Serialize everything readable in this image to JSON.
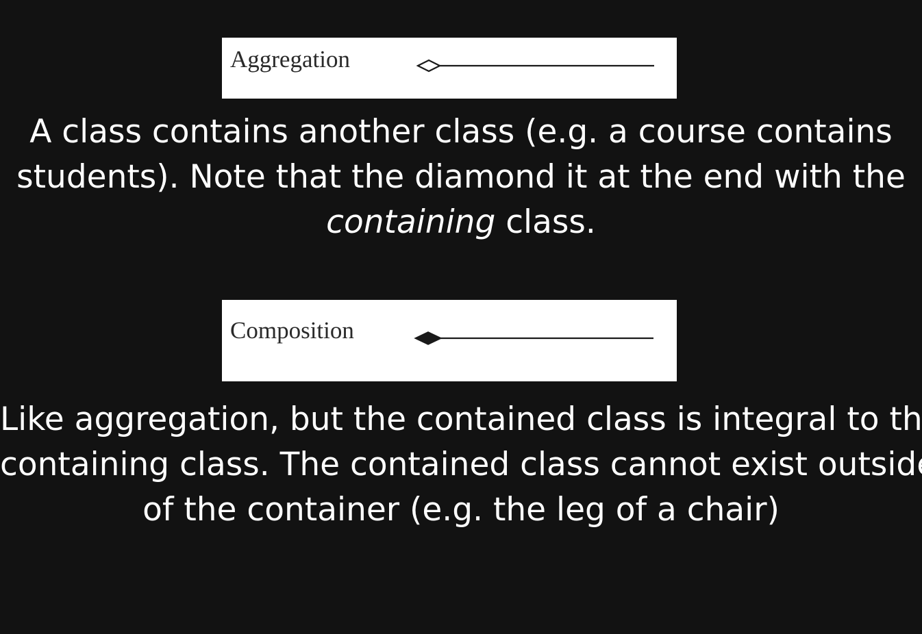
{
  "aggregation": {
    "label": "Aggregation",
    "description": {
      "line1": "A class contains another class (e.g. a course contains",
      "line2": "students). Note that the diamond it at the end with the",
      "line3_emphasis": "containing",
      "line3_rest": " class."
    }
  },
  "composition": {
    "label": "Composition",
    "description": {
      "line1": "Like aggregation, but the contained class is integral to the",
      "line2": "containing class. The contained class cannot exist outside",
      "line3": "of the container (e.g. the leg of a chair)"
    }
  },
  "colors": {
    "background": "#121212",
    "box": "#ffffff",
    "symbol": "#1a1a1a",
    "text": "#ffffff"
  },
  "icons": {
    "aggregation_symbol": "hollow-diamond-icon",
    "composition_symbol": "filled-diamond-icon"
  }
}
